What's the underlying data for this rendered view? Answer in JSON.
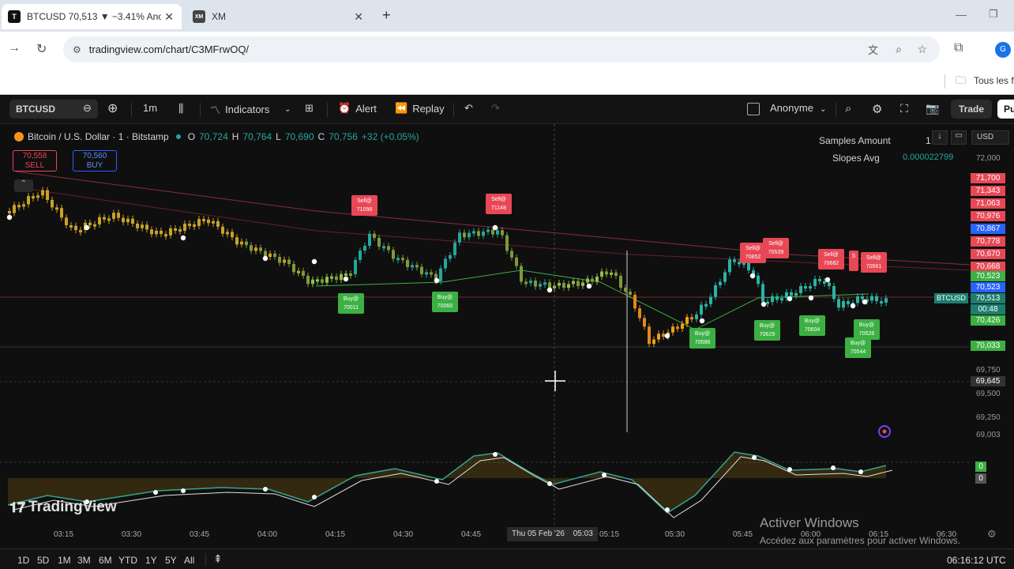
{
  "browser": {
    "tabs": [
      {
        "title": "BTCUSD 70,513 ▼ −3.41% Ano",
        "favicon": "TV",
        "active": true
      },
      {
        "title": "XM",
        "favicon": "XM",
        "active": false
      }
    ],
    "new_tab_label": "+",
    "url": "tradingview.com/chart/C3MFrwOQ/",
    "bookmark": "Tous les f",
    "profile_initial": "G"
  },
  "toolbar": {
    "symbol": "BTCUSD",
    "interval": "1m",
    "indicators": "Indicators",
    "alert": "Alert",
    "replay": "Replay",
    "layout_name": "Anonyme",
    "trade": "Trade",
    "publish": "Pu"
  },
  "legend": {
    "title": "Bitcoin / U.S. Dollar · 1 · Bitstamp",
    "o_label": "O",
    "o": "70,724",
    "h_label": "H",
    "h": "70,764",
    "l_label": "L",
    "l": "70,690",
    "c_label": "C",
    "c": "70,756",
    "change": "+32 (+0.05%)",
    "sell_price": "70,558",
    "sell_label": "SELL",
    "buy_price": "70,560",
    "buy_label": "BUY"
  },
  "indicator_panel": {
    "samples_label": "Samples Amount",
    "samples_value": "1",
    "slopes_label": "Slopes Avg",
    "slopes_value": "0.000022799",
    "currency": "USD"
  },
  "price_axis": {
    "ticks": [
      "72,000",
      "69,750",
      "69,500",
      "69,250",
      "69,003"
    ],
    "boxes": [
      {
        "value": "71,700",
        "color": "#e84855"
      },
      {
        "value": "71,343",
        "color": "#e84855"
      },
      {
        "value": "71,063",
        "color": "#e84855"
      },
      {
        "value": "70,976",
        "color": "#e84855"
      },
      {
        "value": "70,867",
        "color": "#2962ff"
      },
      {
        "value": "70,778",
        "color": "#e84855"
      },
      {
        "value": "70,670",
        "color": "#e84855"
      },
      {
        "value": "70,668",
        "color": "#e84855"
      },
      {
        "value": "70,523",
        "color": "#3cb043"
      },
      {
        "value": "70,523",
        "color": "#2962ff"
      },
      {
        "value": "70,513",
        "color": "#1e7e6e"
      },
      {
        "value": "00:48",
        "color": "#1e7e6e"
      },
      {
        "value": "70,426",
        "color": "#3cb043"
      },
      {
        "value": "70,033",
        "color": "#3cb043"
      },
      {
        "value": "69,645",
        "color": "#333333"
      }
    ],
    "symbol_tag": "BTCUSD",
    "osc_values": [
      "0",
      "0"
    ]
  },
  "signals": [
    {
      "type": "Sell@",
      "price": "71098"
    },
    {
      "type": "Sell@",
      "price": "71148"
    },
    {
      "type": "Sell@",
      "price": "70852"
    },
    {
      "type": "Sell@",
      "price": "70539"
    },
    {
      "type": "Sell@",
      "price": "70682"
    },
    {
      "type": "S",
      "price": ""
    },
    {
      "type": "Sell@",
      "price": "70561"
    },
    {
      "type": "Buy@",
      "price": "70011"
    },
    {
      "type": "Buy@",
      "price": "70060"
    },
    {
      "type": "Buy@",
      "price": "70586"
    },
    {
      "type": "Buy@",
      "price": "70629"
    },
    {
      "type": "Buy@",
      "price": "70604"
    },
    {
      "type": "Buy@",
      "price": "70526"
    },
    {
      "type": "Buy@",
      "price": "70544"
    }
  ],
  "time_axis": {
    "ticks": [
      "03:15",
      "03:30",
      "03:45",
      "04:00",
      "04:15",
      "04:30",
      "04:45",
      "05:15",
      "05:30",
      "05:45",
      "06:00",
      "06:15",
      "06:30"
    ],
    "crosshair_date": "Thu 05 Feb '26",
    "crosshair_time": "05:03"
  },
  "watermark": {
    "brand": "TradingView",
    "activate_title": "Activer Windows",
    "activate_sub": "Accédez aux paramètres pour activer Windows."
  },
  "bottom": {
    "timeframes": [
      "1D",
      "5D",
      "1M",
      "3M",
      "6M",
      "YTD",
      "1Y",
      "5Y",
      "All"
    ],
    "clock": "06:16:12 UTC"
  },
  "colors": {
    "sell": "#e84855",
    "buy": "#3cb043",
    "blue": "#2962ff",
    "teal": "#26a69a",
    "gold": "#d4a017"
  }
}
